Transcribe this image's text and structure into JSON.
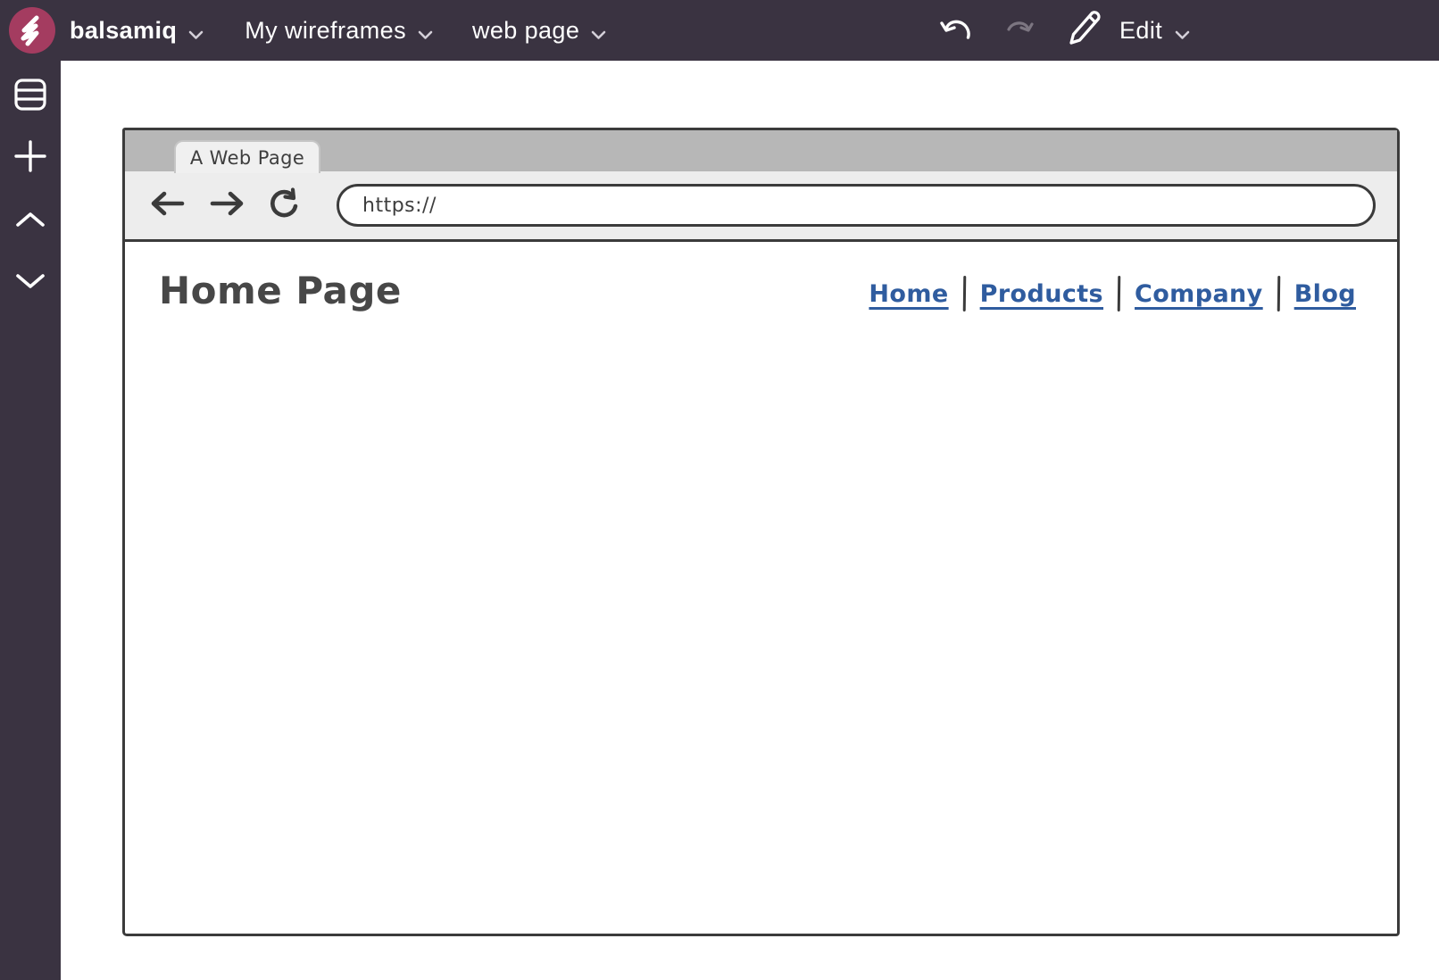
{
  "app": {
    "topbar": {
      "brand_label": "balsamiq",
      "wireframes_menu_label": "My wireframes",
      "page_menu_label": "web page",
      "edit_menu_label": "Edit"
    }
  },
  "wireframe": {
    "browser_tab_title": "A Web Page",
    "url_value": "https://",
    "page_title": "Home Page",
    "nav_links": [
      "Home",
      "Products",
      "Company",
      "Blog"
    ]
  },
  "icons": {
    "logo": "scribble-icon",
    "panels": "stacked-rows-icon",
    "add": "plus-icon",
    "collapse": "chevron-up-icon",
    "expand": "chevron-down-icon",
    "undo": "undo-arrow-icon",
    "redo": "redo-arrow-icon",
    "edit": "pencil-icon",
    "back": "arrow-left-icon",
    "forward": "arrow-right-icon",
    "refresh": "reload-arrow-icon",
    "menu_caret": "chevron-down-icon"
  },
  "colors": {
    "topbar_bg": "#3a3341",
    "logo_pink": "#a43c60",
    "sketch_ink": "#3b3b3b",
    "titlebar_gray": "#b7b7b7",
    "toolbar_gray": "#ededed",
    "link_blue": "#2f5c9f",
    "disabled_icon": "#7c7681"
  }
}
